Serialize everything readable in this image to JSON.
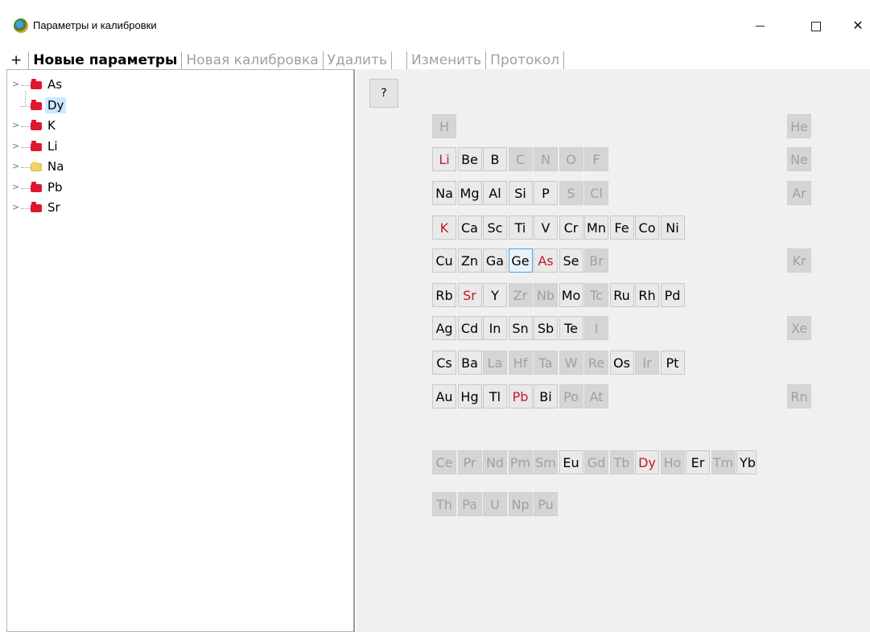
{
  "window": {
    "title": "Параметры и калибровки",
    "min_glyph": "—",
    "close_glyph": "✕"
  },
  "toolbar": {
    "plus_label": "+",
    "new_params_label": "Новые параметры",
    "new_calibration_label": "Новая калибровка",
    "delete_label": "Удалить",
    "edit_label": "Изменить",
    "protocol_label": "Протокол"
  },
  "tree": {
    "items": [
      {
        "label": "As",
        "folder": "red",
        "expandable": true,
        "selected": false
      },
      {
        "label": "Dy",
        "folder": "red",
        "expandable": false,
        "selected": true
      },
      {
        "label": "K",
        "folder": "red",
        "expandable": true,
        "selected": false
      },
      {
        "label": "Li",
        "folder": "red",
        "expandable": true,
        "selected": false
      },
      {
        "label": "Na",
        "folder": "yellow",
        "expandable": true,
        "selected": false
      },
      {
        "label": "Pb",
        "folder": "red",
        "expandable": true,
        "selected": false
      },
      {
        "label": "Sr",
        "folder": "red",
        "expandable": true,
        "selected": false
      }
    ]
  },
  "help_button": "?",
  "periodic_table": {
    "colors": {
      "present": "#c4182c",
      "active": "#000000",
      "inactive": "#a0a0a0",
      "selected_border": "#5aa0d8"
    },
    "elements": [
      {
        "sym": "H",
        "row": 0,
        "col": 0,
        "state": "inactive"
      },
      {
        "sym": "He",
        "row": 0,
        "col": 14,
        "state": "inactive"
      },
      {
        "sym": "Li",
        "row": 1,
        "col": 0,
        "state": "present"
      },
      {
        "sym": "Be",
        "row": 1,
        "col": 1,
        "state": "active"
      },
      {
        "sym": "B",
        "row": 1,
        "col": 2,
        "state": "active"
      },
      {
        "sym": "C",
        "row": 1,
        "col": 3,
        "state": "inactive"
      },
      {
        "sym": "N",
        "row": 1,
        "col": 4,
        "state": "inactive"
      },
      {
        "sym": "O",
        "row": 1,
        "col": 5,
        "state": "inactive"
      },
      {
        "sym": "F",
        "row": 1,
        "col": 6,
        "state": "inactive"
      },
      {
        "sym": "Ne",
        "row": 1,
        "col": 14,
        "state": "inactive"
      },
      {
        "sym": "Na",
        "row": 2,
        "col": 0,
        "state": "active"
      },
      {
        "sym": "Mg",
        "row": 2,
        "col": 1,
        "state": "active"
      },
      {
        "sym": "Al",
        "row": 2,
        "col": 2,
        "state": "active"
      },
      {
        "sym": "Si",
        "row": 2,
        "col": 3,
        "state": "active"
      },
      {
        "sym": "P",
        "row": 2,
        "col": 4,
        "state": "active"
      },
      {
        "sym": "S",
        "row": 2,
        "col": 5,
        "state": "inactive"
      },
      {
        "sym": "Cl",
        "row": 2,
        "col": 6,
        "state": "inactive"
      },
      {
        "sym": "Ar",
        "row": 2,
        "col": 14,
        "state": "inactive"
      },
      {
        "sym": "K",
        "row": 3,
        "col": 0,
        "state": "present"
      },
      {
        "sym": "Ca",
        "row": 3,
        "col": 1,
        "state": "active"
      },
      {
        "sym": "Sc",
        "row": 3,
        "col": 2,
        "state": "active"
      },
      {
        "sym": "Ti",
        "row": 3,
        "col": 3,
        "state": "active"
      },
      {
        "sym": "V",
        "row": 3,
        "col": 4,
        "state": "active"
      },
      {
        "sym": "Cr",
        "row": 3,
        "col": 5,
        "state": "active"
      },
      {
        "sym": "Mn",
        "row": 3,
        "col": 6,
        "state": "active"
      },
      {
        "sym": "Fe",
        "row": 3,
        "col": 7,
        "state": "active"
      },
      {
        "sym": "Co",
        "row": 3,
        "col": 8,
        "state": "active"
      },
      {
        "sym": "Ni",
        "row": 3,
        "col": 9,
        "state": "active"
      },
      {
        "sym": "Cu",
        "row": 4,
        "col": 0,
        "state": "active"
      },
      {
        "sym": "Zn",
        "row": 4,
        "col": 1,
        "state": "active"
      },
      {
        "sym": "Ga",
        "row": 4,
        "col": 2,
        "state": "active"
      },
      {
        "sym": "Ge",
        "row": 4,
        "col": 3,
        "state": "selected"
      },
      {
        "sym": "As",
        "row": 4,
        "col": 4,
        "state": "present"
      },
      {
        "sym": "Se",
        "row": 4,
        "col": 5,
        "state": "active"
      },
      {
        "sym": "Br",
        "row": 4,
        "col": 6,
        "state": "inactive"
      },
      {
        "sym": "Kr",
        "row": 4,
        "col": 14,
        "state": "inactive"
      },
      {
        "sym": "Rb",
        "row": 5,
        "col": 0,
        "state": "active"
      },
      {
        "sym": "Sr",
        "row": 5,
        "col": 1,
        "state": "present"
      },
      {
        "sym": "Y",
        "row": 5,
        "col": 2,
        "state": "active"
      },
      {
        "sym": "Zr",
        "row": 5,
        "col": 3,
        "state": "inactive"
      },
      {
        "sym": "Nb",
        "row": 5,
        "col": 4,
        "state": "inactive"
      },
      {
        "sym": "Mo",
        "row": 5,
        "col": 5,
        "state": "active"
      },
      {
        "sym": "Tc",
        "row": 5,
        "col": 6,
        "state": "inactive"
      },
      {
        "sym": "Ru",
        "row": 5,
        "col": 7,
        "state": "active"
      },
      {
        "sym": "Rh",
        "row": 5,
        "col": 8,
        "state": "active"
      },
      {
        "sym": "Pd",
        "row": 5,
        "col": 9,
        "state": "active"
      },
      {
        "sym": "Ag",
        "row": 6,
        "col": 0,
        "state": "active"
      },
      {
        "sym": "Cd",
        "row": 6,
        "col": 1,
        "state": "active"
      },
      {
        "sym": "In",
        "row": 6,
        "col": 2,
        "state": "active"
      },
      {
        "sym": "Sn",
        "row": 6,
        "col": 3,
        "state": "active"
      },
      {
        "sym": "Sb",
        "row": 6,
        "col": 4,
        "state": "active"
      },
      {
        "sym": "Te",
        "row": 6,
        "col": 5,
        "state": "active"
      },
      {
        "sym": "I",
        "row": 6,
        "col": 6,
        "state": "inactive"
      },
      {
        "sym": "Xe",
        "row": 6,
        "col": 14,
        "state": "inactive"
      },
      {
        "sym": "Cs",
        "row": 7,
        "col": 0,
        "state": "active"
      },
      {
        "sym": "Ba",
        "row": 7,
        "col": 1,
        "state": "active"
      },
      {
        "sym": "La",
        "row": 7,
        "col": 2,
        "state": "inactive"
      },
      {
        "sym": "Hf",
        "row": 7,
        "col": 3,
        "state": "inactive"
      },
      {
        "sym": "Ta",
        "row": 7,
        "col": 4,
        "state": "inactive"
      },
      {
        "sym": "W",
        "row": 7,
        "col": 5,
        "state": "inactive"
      },
      {
        "sym": "Re",
        "row": 7,
        "col": 6,
        "state": "inactive"
      },
      {
        "sym": "Os",
        "row": 7,
        "col": 7,
        "state": "active"
      },
      {
        "sym": "Ir",
        "row": 7,
        "col": 8,
        "state": "inactive"
      },
      {
        "sym": "Pt",
        "row": 7,
        "col": 9,
        "state": "active"
      },
      {
        "sym": "Au",
        "row": 8,
        "col": 0,
        "state": "active"
      },
      {
        "sym": "Hg",
        "row": 8,
        "col": 1,
        "state": "active"
      },
      {
        "sym": "Tl",
        "row": 8,
        "col": 2,
        "state": "active"
      },
      {
        "sym": "Pb",
        "row": 8,
        "col": 3,
        "state": "present"
      },
      {
        "sym": "Bi",
        "row": 8,
        "col": 4,
        "state": "active"
      },
      {
        "sym": "Po",
        "row": 8,
        "col": 5,
        "state": "inactive"
      },
      {
        "sym": "At",
        "row": 8,
        "col": 6,
        "state": "inactive"
      },
      {
        "sym": "Rn",
        "row": 8,
        "col": 14,
        "state": "inactive"
      },
      {
        "sym": "Ce",
        "row": 9,
        "col": 0,
        "state": "inactive"
      },
      {
        "sym": "Pr",
        "row": 9,
        "col": 1,
        "state": "inactive"
      },
      {
        "sym": "Nd",
        "row": 9,
        "col": 2,
        "state": "inactive"
      },
      {
        "sym": "Pm",
        "row": 9,
        "col": 3,
        "state": "inactive"
      },
      {
        "sym": "Sm",
        "row": 9,
        "col": 4,
        "state": "inactive"
      },
      {
        "sym": "Eu",
        "row": 9,
        "col": 5,
        "state": "active"
      },
      {
        "sym": "Gd",
        "row": 9,
        "col": 6,
        "state": "inactive"
      },
      {
        "sym": "Tb",
        "row": 9,
        "col": 7,
        "state": "inactive"
      },
      {
        "sym": "Dy",
        "row": 9,
        "col": 8,
        "state": "present"
      },
      {
        "sym": "Ho",
        "row": 9,
        "col": 9,
        "state": "inactive"
      },
      {
        "sym": "Er",
        "row": 9,
        "col": 10,
        "state": "active"
      },
      {
        "sym": "Tm",
        "row": 9,
        "col": 11,
        "state": "inactive"
      },
      {
        "sym": "Yb",
        "row": 9,
        "col": 12,
        "state": "active"
      },
      {
        "sym": "Th",
        "row": 10,
        "col": 0,
        "state": "inactive"
      },
      {
        "sym": "Pa",
        "row": 10,
        "col": 1,
        "state": "inactive"
      },
      {
        "sym": "U",
        "row": 10,
        "col": 2,
        "state": "inactive"
      },
      {
        "sym": "Np",
        "row": 10,
        "col": 3,
        "state": "inactive"
      },
      {
        "sym": "Pu",
        "row": 10,
        "col": 4,
        "state": "inactive"
      }
    ]
  }
}
